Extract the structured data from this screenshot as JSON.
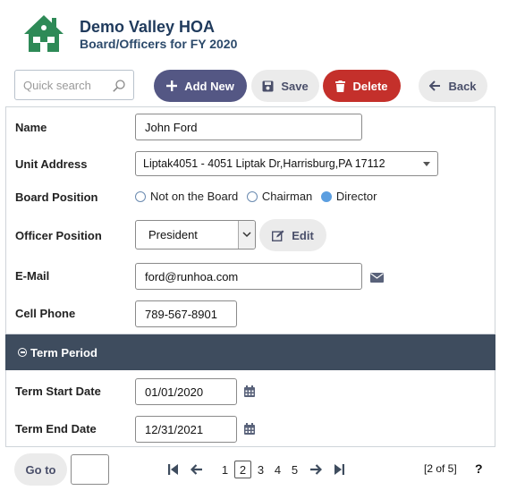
{
  "header": {
    "org_name": "Demo Valley HOA",
    "subtitle": "Board/Officers for FY 2020"
  },
  "toolbar": {
    "search_placeholder": "Quick search",
    "add_label": "Add New",
    "save_label": "Save",
    "delete_label": "Delete",
    "back_label": "Back"
  },
  "form": {
    "name_label": "Name",
    "name_value": "John Ford",
    "unit_label": "Unit Address",
    "unit_value": "Liptak4051 - 4051 Liptak Dr,Harrisburg,PA 17112",
    "board_label": "Board Position",
    "board_options": [
      "Not on the Board",
      "Chairman",
      "Director"
    ],
    "board_selected": "Director",
    "officer_label": "Officer Position",
    "officer_value": "President",
    "edit_label": "Edit",
    "email_label": "E-Mail",
    "email_value": "ford@runhoa.com",
    "phone_label": "Cell Phone",
    "phone_value": "789-567-8901"
  },
  "term": {
    "section_title": "Term Period",
    "start_label": "Term Start Date",
    "start_value": "01/01/2020",
    "end_label": "Term End Date",
    "end_value": "12/31/2021"
  },
  "footer": {
    "goto_label": "Go to",
    "goto_value": "",
    "pages": [
      "1",
      "2",
      "3",
      "4",
      "5"
    ],
    "current_page": "2",
    "record_count": "[2 of 5]",
    "help": "?"
  },
  "colors": {
    "primary_button": "#545784",
    "delete_button": "#c4302b",
    "section_header": "#3e4c5e",
    "title": "#1f3a5c"
  },
  "icons": [
    "house-logo-icon",
    "search-icon",
    "plus-icon",
    "save-icon",
    "trash-icon",
    "arrow-left-icon",
    "edit-icon",
    "envelope-icon",
    "calendar-icon",
    "first-page-icon",
    "prev-page-icon",
    "next-page-icon",
    "last-page-icon"
  ]
}
